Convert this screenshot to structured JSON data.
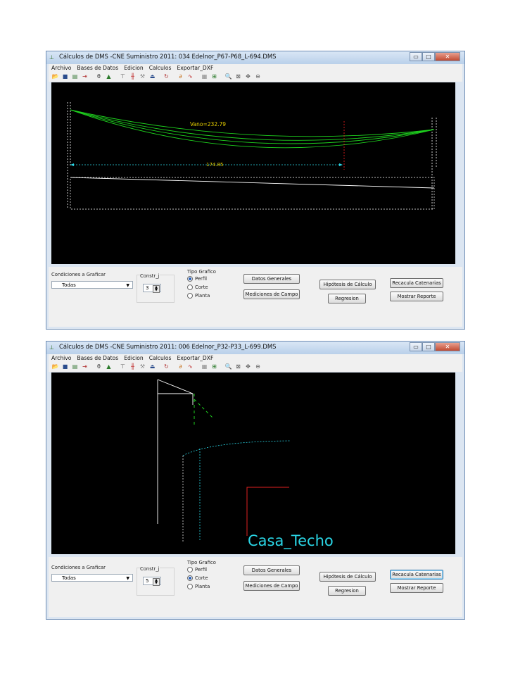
{
  "icons": {
    "app": "app-icon",
    "minimize": "minimize-icon",
    "maximize": "maximize-icon",
    "close": "close-icon"
  },
  "menu": [
    "Archivo",
    "Bases de Datos",
    "Edicion",
    "Calculos",
    "Exportar_DXF"
  ],
  "toolbar_icons": [
    "open-icon",
    "save-icon",
    "db-icon",
    "import-icon",
    "sep",
    "calc-icon",
    "chart-icon",
    "sep",
    "tool-icon",
    "pole-icon",
    "tension-icon",
    "clearance-icon",
    "sep",
    "refresh-icon",
    "sep",
    "line-icon",
    "wire-icon",
    "sep",
    "table-icon",
    "scale-icon",
    "sep",
    "zoom-icon",
    "fit-icon",
    "pan-icon",
    "zoom-out-icon"
  ],
  "panel": {
    "condiciones_label": "Condiciones a Graficar",
    "condiciones_value": "Todas",
    "constr_label": "Constr_j",
    "tipo_label": "Tipo Grafico",
    "radio_perfil": "Perfil",
    "radio_corte": "Corte",
    "radio_planta": "Planta",
    "btn_datos": "Datos Generales",
    "btn_mediciones": "Mediciones de Campo",
    "btn_hipotesis": "Hipótesis de Cálculo",
    "btn_regresion": "Regresion",
    "btn_recacula": "Recacula Catenarias",
    "btn_reporte": "Mostrar Reporte"
  },
  "windows": [
    {
      "title": "Cálculos de DMS -CNE Suministro 2011: 034 Edelnor_P67-P68_L-694.DMS",
      "constr_value": "3",
      "selected_view": "Perfil",
      "focused_button": "",
      "drawing": {
        "vano_label": "Vano=232.79",
        "distance_label": "174.85"
      }
    },
    {
      "title": "Cálculos de DMS -CNE Suministro 2011: 006 Edelnor_P32-P33_L-699.DMS",
      "constr_value": "5",
      "selected_view": "Corte",
      "focused_button": "recacula",
      "drawing": {
        "label": "Casa_Techo"
      }
    }
  ]
}
